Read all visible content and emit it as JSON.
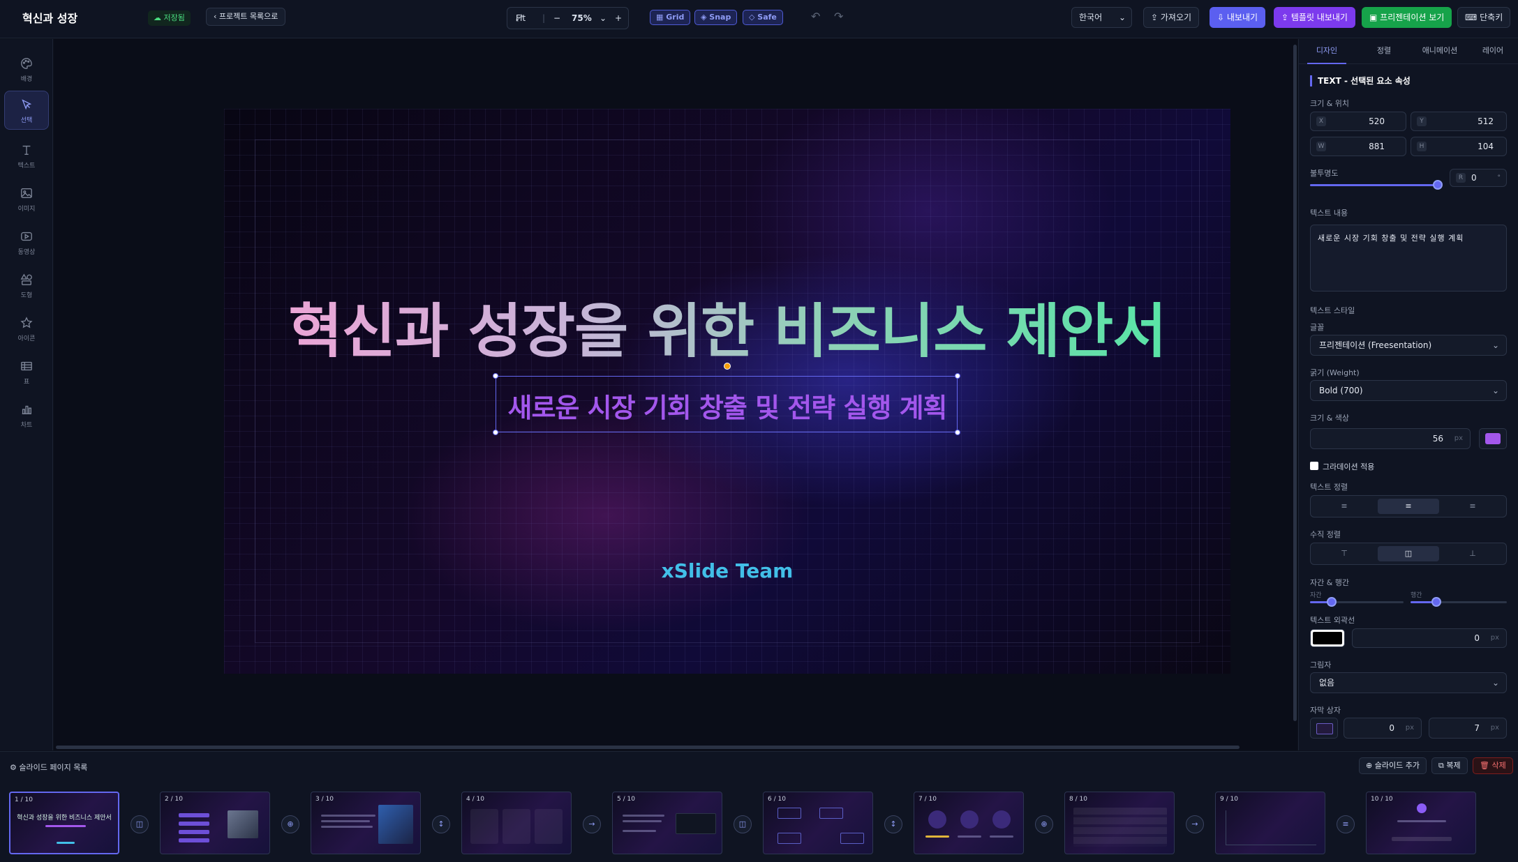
{
  "header": {
    "title": "혁신과 성장",
    "saved_badge": "저장됨",
    "back_button": "프로젝트 목록으로",
    "fit_label": "Fit",
    "zoom_value": "75%",
    "grid_toggle": "Grid",
    "snap_toggle": "Snap",
    "safe_toggle": "Safe",
    "language": "한국어",
    "import_button": "가져오기",
    "export_button": "내보내기",
    "template_export_button": "템플릿 내보내기",
    "present_button": "프리젠테이션 보기",
    "shortcuts_button": "단축키"
  },
  "tools": [
    {
      "label": "배경",
      "icon": "palette-icon"
    },
    {
      "label": "선택",
      "icon": "pointer-icon"
    },
    {
      "label": "텍스트",
      "icon": "text-icon"
    },
    {
      "label": "이미지",
      "icon": "image-icon"
    },
    {
      "label": "동영상",
      "icon": "video-icon"
    },
    {
      "label": "도형",
      "icon": "shapes-icon"
    },
    {
      "label": "아이콘",
      "icon": "star-icon"
    },
    {
      "label": "표",
      "icon": "table-icon"
    },
    {
      "label": "차트",
      "icon": "chart-icon"
    }
  ],
  "slide": {
    "title": "혁신과 성장을 위한 비즈니스 제안서",
    "subtitle": "새로운 시장 기회 창출 및 전략 실행 계획",
    "team": "xSlide Team"
  },
  "panel": {
    "tabs": [
      "디자인",
      "정렬",
      "애니메이션",
      "레이어"
    ],
    "section_title": "TEXT - 선택된 요소 속성",
    "size_position_label": "크기 & 위치",
    "x_tag": "X",
    "x": "520",
    "y_tag": "Y",
    "y": "512",
    "w_tag": "W",
    "w": "881",
    "h_tag": "H",
    "h": "104",
    "opacity_label": "불투명도",
    "rotation_tag": "R",
    "rotation_value": "0",
    "rotation_unit": "°",
    "text_content_label": "텍스트 내용",
    "text_content": "새로운 시장 기회 창출 및 전략 실행 계획",
    "text_style_label": "텍스트 스타일",
    "font_label": "글꼴",
    "font_value": "프리젠테이션 (Freesentation)",
    "weight_label": "굵기 (Weight)",
    "weight_value": "Bold (700)",
    "size_color_label": "크기 & 색상",
    "font_size": "56",
    "px_unit": "px",
    "text_color": "#a357ec",
    "gradient_label": "그라데이션 적용",
    "align_label": "텍스트 정렬",
    "valign_label": "수직 정렬",
    "spacing_label": "자간 & 행간",
    "letter_spacing_label": "자간",
    "line_height_label": "행간",
    "stroke_label": "텍스트 외곽선",
    "stroke_value": "0",
    "shadow_label": "그림자",
    "shadow_value": "없음",
    "textbox_label": "자막 상자",
    "textbox_value1": "0",
    "textbox_value2": "7"
  },
  "bottom": {
    "list_label": "슬라이드 페이지 목록",
    "add_button": "슬라이드 추가",
    "duplicate_button": "복제",
    "delete_button": "삭제",
    "thumbnails": [
      {
        "num": "1 / 10",
        "title": "혁신과 성장을 위한 비즈니스 제안서"
      },
      {
        "num": "2 / 10",
        "title": ""
      },
      {
        "num": "3 / 10",
        "title": ""
      },
      {
        "num": "4 / 10",
        "title": ""
      },
      {
        "num": "5 / 10",
        "title": ""
      },
      {
        "num": "6 / 10",
        "title": ""
      },
      {
        "num": "7 / 10",
        "title": ""
      },
      {
        "num": "8 / 10",
        "title": ""
      },
      {
        "num": "9 / 10",
        "title": ""
      },
      {
        "num": "10 / 10",
        "title": ""
      }
    ]
  },
  "colors": {
    "accent": "#6468f0",
    "present": "#16a34a",
    "export": "#6366f1",
    "template": "#7c3aed"
  }
}
